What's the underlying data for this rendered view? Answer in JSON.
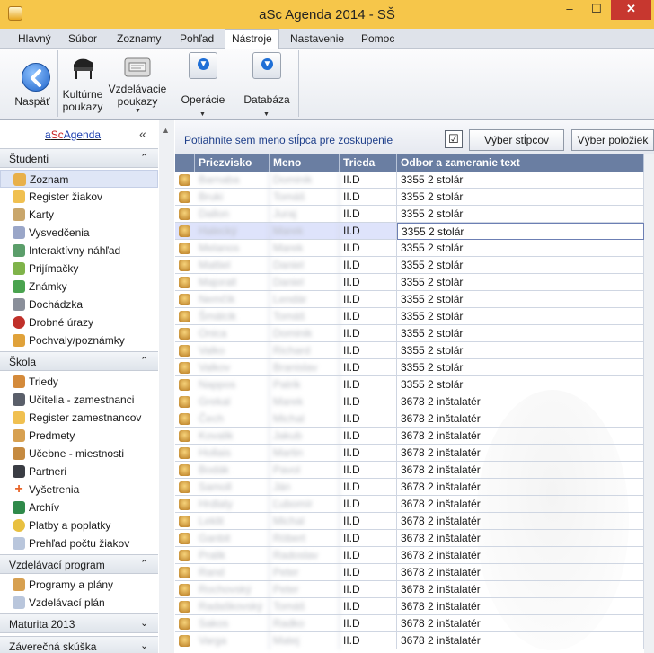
{
  "window": {
    "title": "aSc Agenda 2014 - SŠ",
    "minimize_glyph": "–",
    "maximize_glyph": "☐",
    "close_glyph": "✕"
  },
  "menu": {
    "tabs": [
      "Hlavný",
      "Súbor",
      "Zoznamy",
      "Pohľad",
      "Nástroje",
      "Nastavenie",
      "Pomoc"
    ],
    "active_tab": "Nástroje"
  },
  "ribbon": {
    "back_label": "Naspäť",
    "cultural_label_1": "Kultúrne",
    "cultural_label_2": "poukazy",
    "education_label_1": "Vzdelávacie",
    "education_label_2": "poukazy",
    "operations_label": "Operácie",
    "database_label": "Databáza"
  },
  "sidebar": {
    "brand_a": "a",
    "brand_sc": "Sc",
    "brand_agenda": "Agenda",
    "collapse_glyph": "«",
    "sections": {
      "studenti": {
        "title": "Študenti",
        "chevron": "⌃",
        "items": [
          "Zoznam",
          "Register žiakov",
          "Karty",
          "Vysvedčenia",
          "Interaktívny náhľad",
          "Prijímačky",
          "Známky",
          "Dochádzka",
          "Drobné úrazy",
          "Pochvaly/poznámky"
        ]
      },
      "skola": {
        "title": "Škola",
        "chevron": "⌃",
        "items": [
          "Triedy",
          "Učitelia - zamestnanci",
          "Register zamestnancov",
          "Predmety",
          "Učebne - miestnosti",
          "Partneri",
          "Vyšetrenia",
          "Archív",
          "Platby a poplatky",
          "Prehľad počtu žiakov"
        ]
      },
      "program": {
        "title": "Vzdelávací program",
        "chevron": "⌃",
        "items": [
          "Programy a plány",
          "Vzdelávací plán"
        ]
      },
      "maturita": {
        "title": "Maturita 2013",
        "chevron": "⌄"
      },
      "zaverecna": {
        "title": "Záverečná skúška",
        "chevron": "⌄"
      }
    },
    "selected_item": "Zoznam"
  },
  "grid": {
    "group_hint": "Potiahnite sem meno stĺpca pre zoskupenie",
    "checkbox_glyph": "☑",
    "columns_button": "Výber stĺpcov",
    "items_button": "Výber položiek",
    "headers": [
      "Priezvisko",
      "Meno",
      "Trieda",
      "Odbor a zameranie text"
    ],
    "rows": [
      {
        "surname": "Barnaba",
        "name": "Dominik",
        "class": "II.D",
        "field": "3355 2 stolár"
      },
      {
        "surname": "Bruki",
        "name": "Tomáš",
        "class": "II.D",
        "field": "3355 2 stolár"
      },
      {
        "surname": "Dallon",
        "name": "Juraj",
        "class": "II.D",
        "field": "3355 2 stolár"
      },
      {
        "surname": "Halecký",
        "name": "Marek",
        "class": "II.D",
        "field": "3355 2 stolár"
      },
      {
        "surname": "Melanos",
        "name": "Marek",
        "class": "II.D",
        "field": "3355 2 stolár"
      },
      {
        "surname": "Mattiel",
        "name": "Daniel",
        "class": "II.D",
        "field": "3355 2 stolár"
      },
      {
        "surname": "Majorall",
        "name": "Daniel",
        "class": "II.D",
        "field": "3355 2 stolár"
      },
      {
        "surname": "Nemčík",
        "name": "Lendár",
        "class": "II.D",
        "field": "3355 2 stolár"
      },
      {
        "surname": "Šmálcik",
        "name": "Tomáš",
        "class": "II.D",
        "field": "3355 2 stolár"
      },
      {
        "surname": "Onica",
        "name": "Dominik",
        "class": "II.D",
        "field": "3355 2 stolár"
      },
      {
        "surname": "Valko",
        "name": "Richard",
        "class": "II.D",
        "field": "3355 2 stolár"
      },
      {
        "surname": "Valkov",
        "name": "Branislav",
        "class": "II.D",
        "field": "3355 2 stolár"
      },
      {
        "surname": "Nappos",
        "name": "Patrik",
        "class": "II.D",
        "field": "3355 2 stolár"
      },
      {
        "surname": "Grekal",
        "name": "Marek",
        "class": "II.D",
        "field": "3678 2 inštalatér"
      },
      {
        "surname": "Čech",
        "name": "Michal",
        "class": "II.D",
        "field": "3678 2 inštalatér"
      },
      {
        "surname": "Kovalik",
        "name": "Jakub",
        "class": "II.D",
        "field": "3678 2 inštalatér"
      },
      {
        "surname": "Hollais",
        "name": "Martin",
        "class": "II.D",
        "field": "3678 2 inštalatér"
      },
      {
        "surname": "Bodák",
        "name": "Pavol",
        "class": "II.D",
        "field": "3678 2 inštalatér"
      },
      {
        "surname": "Samoll",
        "name": "Ján",
        "class": "II.D",
        "field": "3678 2 inštalatér"
      },
      {
        "surname": "Hrdlaty",
        "name": "Ľubomír",
        "class": "II.D",
        "field": "3678 2 inštalatér"
      },
      {
        "surname": "Leklit",
        "name": "Michal",
        "class": "II.D",
        "field": "3678 2 inštalatér"
      },
      {
        "surname": "Ganbit",
        "name": "Róbert",
        "class": "II.D",
        "field": "3678 2 inštalatér"
      },
      {
        "surname": "Pralik",
        "name": "Radoslav",
        "class": "II.D",
        "field": "3678 2 inštalatér"
      },
      {
        "surname": "Rand",
        "name": "Peter",
        "class": "II.D",
        "field": "3678 2 inštalatér"
      },
      {
        "surname": "Rochovský",
        "name": "Peter",
        "class": "II.D",
        "field": "3678 2 inštalatér"
      },
      {
        "surname": "Radaškovský",
        "name": "Tomáš",
        "class": "II.D",
        "field": "3678 2 inštalatér"
      },
      {
        "surname": "Sakos",
        "name": "Radko",
        "class": "II.D",
        "field": "3678 2 inštalatér"
      },
      {
        "surname": "Varga",
        "name": "Matej",
        "class": "II.D",
        "field": "3678 2 inštalatér"
      }
    ],
    "selected_row": 3
  }
}
